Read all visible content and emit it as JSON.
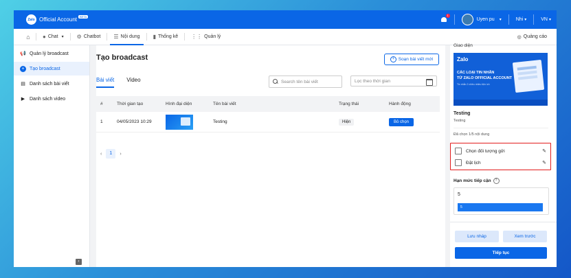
{
  "topbar": {
    "logo_mark": "Zalo",
    "logo_text": "Official Account",
    "beta": "BETA",
    "notification_count": "1",
    "user_name": "Uyen pu",
    "region": "Nhi",
    "language": "VN"
  },
  "tabs": [
    {
      "label": "Chat",
      "icon": "chat-icon"
    },
    {
      "label": "Chatbot",
      "icon": "bot-icon"
    },
    {
      "label": "Nội dung",
      "icon": "list-icon"
    },
    {
      "label": "Thống kê",
      "icon": "bar-chart-icon"
    },
    {
      "label": "Quản lý",
      "icon": "grid-icon"
    }
  ],
  "ads_label": "Quảng cáo",
  "sidebar": {
    "items": [
      {
        "label": "Quản lý broadcast",
        "icon": "megaphone-icon"
      },
      {
        "label": "Tạo broadcast",
        "icon": "plus-circle-icon"
      },
      {
        "label": "Danh sách bài viết",
        "icon": "document-icon"
      },
      {
        "label": "Danh sách video",
        "icon": "video-icon"
      }
    ]
  },
  "main": {
    "title": "Tạo broadcast",
    "compose_button": "Soạn bài viết mới",
    "subtabs": [
      "Bài viết",
      "Video"
    ],
    "search_placeholder": "Search tên bài viết",
    "date_placeholder": "Lọc theo thời gian",
    "table": {
      "headers": [
        "#",
        "Thời gian tạo",
        "Hình đại diện",
        "Tên bài viết",
        "Trạng thái",
        "Hành động"
      ],
      "rows": [
        {
          "index": "1",
          "created": "04/05/2023 10:29",
          "name": "Testing",
          "status": "Hiện",
          "action": "Bỏ chọn"
        }
      ]
    },
    "pagination": {
      "prev": "‹",
      "current": "1",
      "next": "›"
    }
  },
  "right_panel": {
    "header": "Giao diện",
    "banner": {
      "logo": "Zalo",
      "line1": "CÁC LOẠI TIN NHẮN",
      "line2": "TỪ ZALO OFFICIAL ACCOUNT",
      "line3": "Tin nhắn 2 chiều nhiều tiện ích"
    },
    "article_title": "Testing",
    "article_sub": "Testing",
    "selected_count": "Đã chọn 1/5 nội dung",
    "options": [
      "Chọn đối tượng gửi",
      "Đặt lịch"
    ],
    "reach_label": "Hạn mức tiếp cận",
    "reach_value": "5",
    "reach_bar_value": "5",
    "buttons": {
      "draft": "Lưu nháp",
      "preview": "Xem trước",
      "next": "Tiếp tục"
    }
  }
}
